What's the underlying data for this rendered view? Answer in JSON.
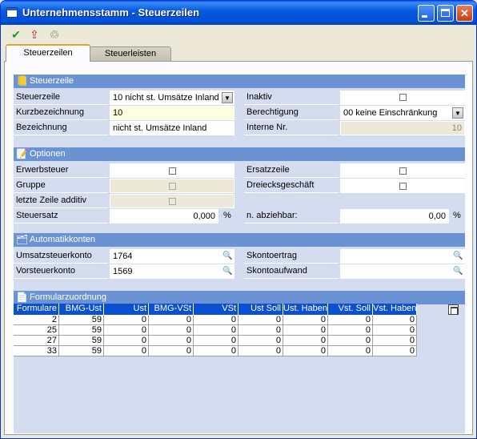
{
  "window": {
    "title": "Unternehmensstamm - Steuerzeilen"
  },
  "toolbar": [
    {
      "icon": "check-icon",
      "glyph": "✔",
      "color": "#1f9a1f"
    },
    {
      "icon": "exit-icon",
      "glyph": "⇪",
      "color": "#b02828"
    },
    {
      "icon": "delete-icon",
      "glyph": "♲",
      "color": "#4d6a4d"
    }
  ],
  "tabs": [
    "Steuerzeilen",
    "Steuerleisten"
  ],
  "sections": {
    "steuerzeile": "Steuerzeile",
    "optionen": "Optionen",
    "automatikkonten": "Automatikkonten",
    "formularzuordnung": "Formularzuordnung"
  },
  "fields": {
    "steuerzeile": {
      "label": "Steuerzeile",
      "value": "10  nicht st. Umsätze Inland"
    },
    "inaktiv": {
      "label": "Inaktiv"
    },
    "kurzbezeichnung": {
      "label": "Kurzbezeichnung",
      "value": "10"
    },
    "berechtigung": {
      "label": "Berechtigung",
      "value": "00 keine Einschränkung"
    },
    "bezeichnung": {
      "label": "Bezeichnung",
      "value": "nicht st. Umsätze Inland"
    },
    "interne_nr": {
      "label": "Interne Nr.",
      "value": "10"
    },
    "erwerbsteuer": {
      "label": "Erwerbsteuer"
    },
    "ersatzzeile": {
      "label": "Ersatzzeile"
    },
    "gruppe": {
      "label": "Gruppe"
    },
    "dreiecksgeschaeft": {
      "label": "Dreiecksgeschäft"
    },
    "letzte_zeile": {
      "label": "letzte Zeile additiv"
    },
    "steuersatz": {
      "label": "Steuersatz",
      "value": "0,000",
      "unit": "%"
    },
    "abziehbar": {
      "label": "n. abziehbar:",
      "value": "0,00",
      "unit": "%"
    },
    "umsatzsteuerkonto": {
      "label": "Umsatzsteuerkonto",
      "value": "1764"
    },
    "skontoertrag": {
      "label": "Skontoertrag",
      "value": ""
    },
    "vorsteuerkonto": {
      "label": "Vorsteuerkonto",
      "value": "1569"
    },
    "skontoaufwand": {
      "label": "Skontoaufwand",
      "value": ""
    }
  },
  "grid": {
    "columns": [
      "Formulare",
      "BMG-Ust",
      "Ust",
      "BMG-VSt",
      "VSt",
      "Ust Soll",
      "Ust. Haben",
      "Vst. Soll",
      "Vst. Haben"
    ],
    "rows": [
      [
        "2",
        "59",
        "0",
        "0",
        "0",
        "0",
        "0",
        "0",
        "0"
      ],
      [
        "25",
        "59",
        "0",
        "0",
        "0",
        "0",
        "0",
        "0",
        "0"
      ],
      [
        "27",
        "59",
        "0",
        "0",
        "0",
        "0",
        "0",
        "0",
        "0"
      ],
      [
        "33",
        "59",
        "0",
        "0",
        "0",
        "0",
        "0",
        "0",
        "0"
      ]
    ]
  }
}
